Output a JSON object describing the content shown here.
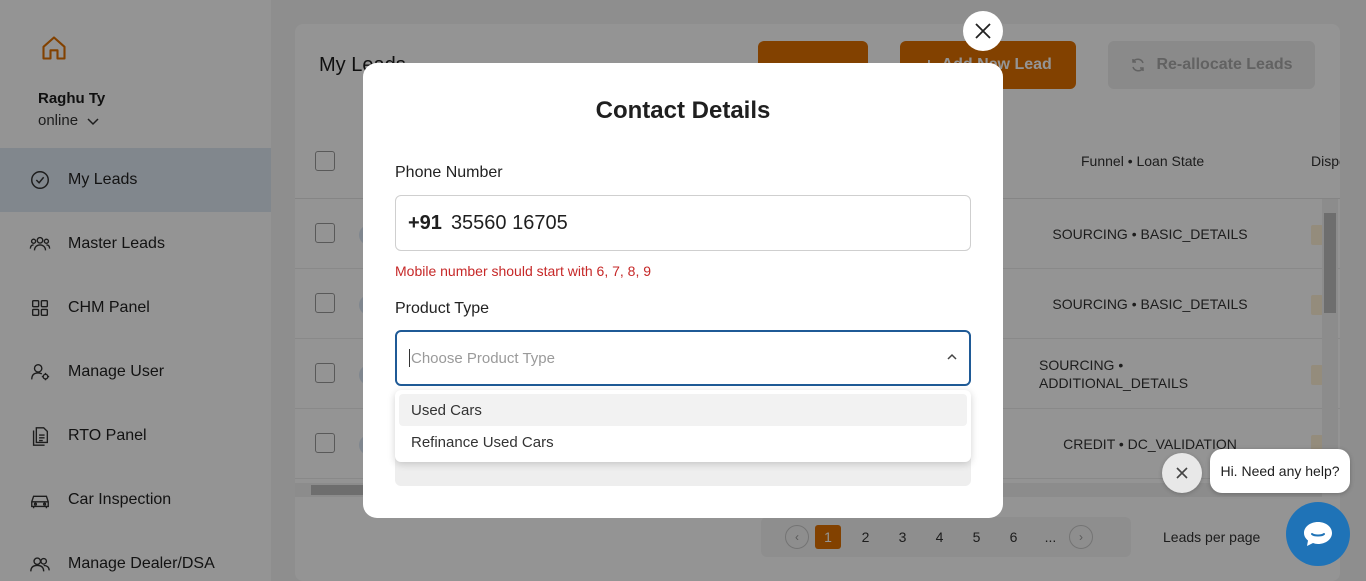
{
  "sidebar": {
    "user_name": "Raghu Ty",
    "status": "online",
    "items": [
      {
        "label": "My Leads",
        "icon": "check-circle-icon",
        "active": true
      },
      {
        "label": "Master Leads",
        "icon": "users-icon"
      },
      {
        "label": "CHM Panel",
        "icon": "grid-icon"
      },
      {
        "label": "Manage User",
        "icon": "user-settings-icon"
      },
      {
        "label": "RTO Panel",
        "icon": "documents-icon"
      },
      {
        "label": "Car Inspection",
        "icon": "car-icon"
      },
      {
        "label": "Manage Dealer/DSA",
        "icon": "group-icon"
      }
    ]
  },
  "main": {
    "title": "My Leads",
    "add_lead_label": "Add New Lead",
    "reallocate_label": "Re-allocate Leads",
    "table": {
      "funnel_header": "Funnel • Loan State",
      "disp_header": "Disposition",
      "rows": [
        {
          "funnel": "SOURCING • BASIC_DETAILS"
        },
        {
          "funnel": "SOURCING • BASIC_DETAILS"
        },
        {
          "funnel_line1": "SOURCING •",
          "funnel_line2": "ADDITIONAL_DETAILS"
        },
        {
          "funnel": "CREDIT • DC_VALIDATION"
        }
      ]
    },
    "pagination": {
      "pages": [
        "1",
        "2",
        "3",
        "4",
        "5",
        "6",
        "..."
      ],
      "current": "1",
      "per_page_label": "Leads per page"
    }
  },
  "modal": {
    "title": "Contact Details",
    "phone_label": "Phone Number",
    "country_code": "+91",
    "phone_value": "35560 16705",
    "phone_error": "Mobile number should start with 6, 7, 8, 9",
    "product_label": "Product Type",
    "product_placeholder": "Choose Product Type",
    "product_options": [
      "Used Cars",
      "Refinance Used Cars"
    ]
  },
  "chat": {
    "bubble_text": "Hi. Need any help?"
  },
  "colors": {
    "accent": "#e07000",
    "focus": "#1f5a96",
    "error": "#c62828",
    "chat": "#1f73b7"
  }
}
